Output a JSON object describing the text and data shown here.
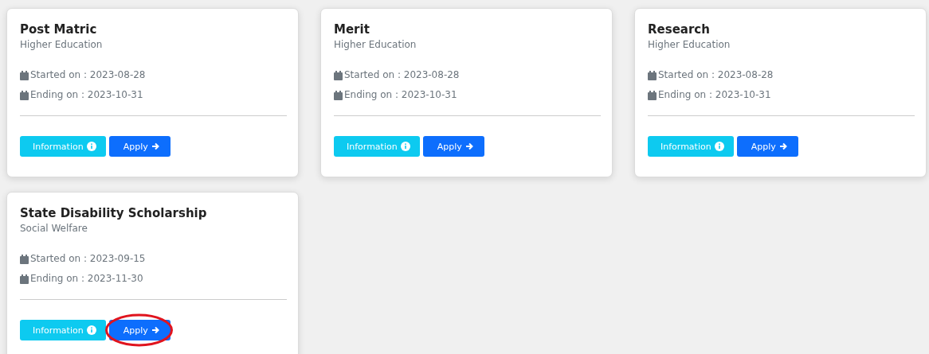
{
  "cards": [
    {
      "title": "Post Matric",
      "category": "Higher Education",
      "started": "Started on : 2023-08-28",
      "ending": "Ending on : 2023-10-31",
      "info_button": "Information",
      "apply_button": "Apply",
      "apply_circled": false
    },
    {
      "title": "Merit",
      "category": "Higher Education",
      "started": "Started on : 2023-08-28",
      "ending": "Ending on : 2023-10-31",
      "info_button": "Information",
      "apply_button": "Apply",
      "apply_circled": false
    },
    {
      "title": "Research",
      "category": "Higher Education",
      "started": "Started on : 2023-08-28",
      "ending": "Ending on : 2023-10-31",
      "info_button": "Information",
      "apply_button": "Apply",
      "apply_circled": false
    },
    {
      "title": "State Disability Scholarship",
      "category": "Social Welfare",
      "started": "Started on : 2023-09-15",
      "ending": "Ending on : 2023-11-30",
      "info_button": "Information",
      "apply_button": "Apply",
      "apply_circled": true
    }
  ]
}
